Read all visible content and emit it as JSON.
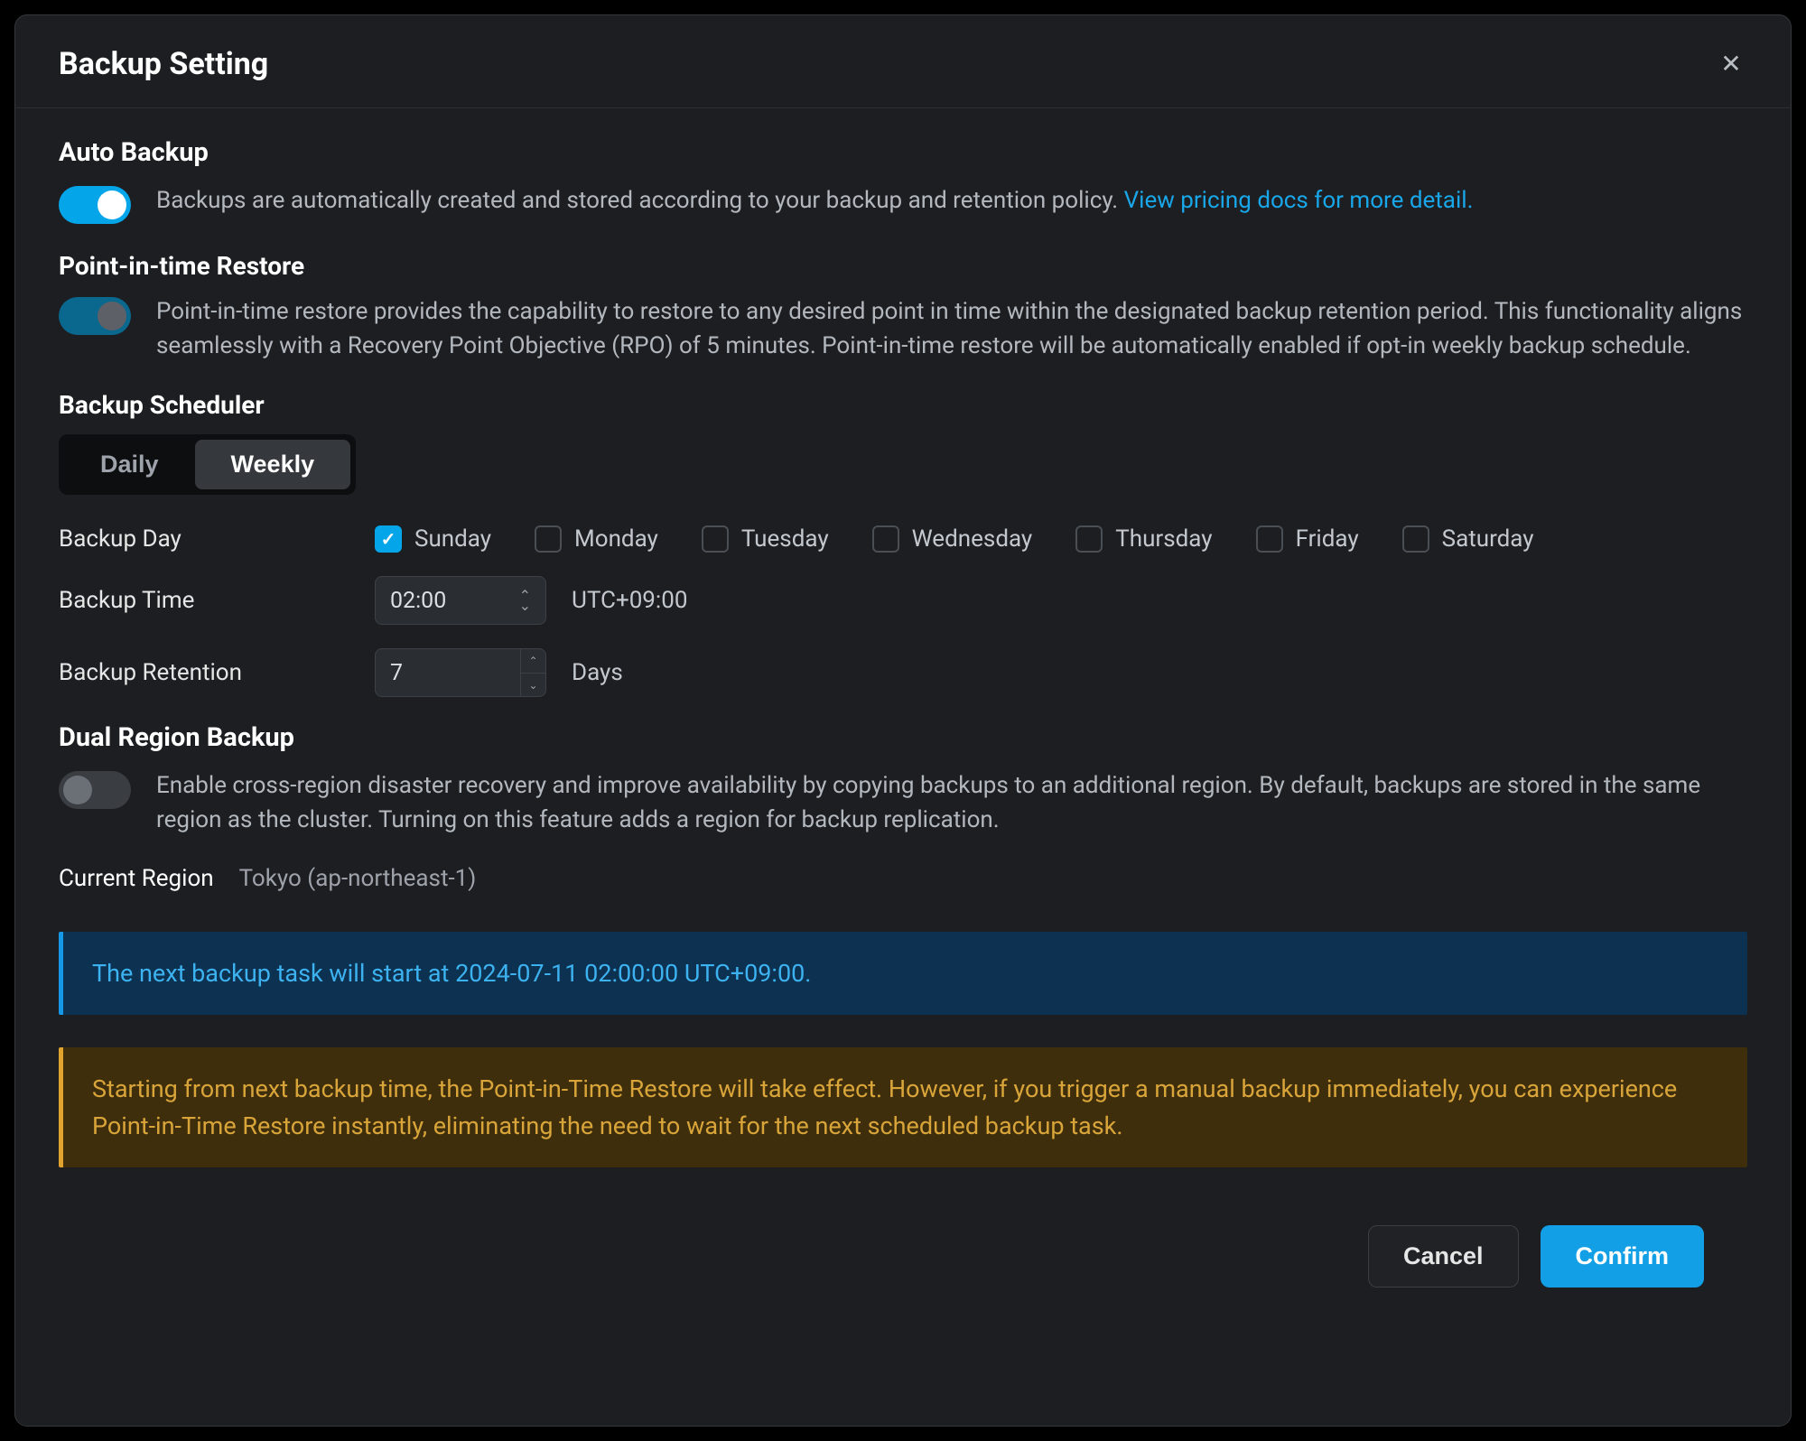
{
  "modal": {
    "title": "Backup Setting"
  },
  "autoBackup": {
    "title": "Auto Backup",
    "description": "Backups are automatically created and stored according to your backup and retention policy. ",
    "link": "View pricing docs for more detail.",
    "enabled": true
  },
  "pitr": {
    "title": "Point-in-time Restore",
    "description": "Point-in-time restore provides the capability to restore to any desired point in time within the designated backup retention period. This functionality aligns seamlessly with a Recovery Point Objective (RPO) of 5 minutes. Point-in-time restore will be automatically enabled if opt-in weekly backup schedule.",
    "enabled": true
  },
  "scheduler": {
    "title": "Backup Scheduler",
    "tabs": {
      "daily": "Daily",
      "weekly": "Weekly"
    },
    "activeTab": "weekly",
    "dayLabel": "Backup Day",
    "days": {
      "sunday": {
        "label": "Sunday",
        "checked": true
      },
      "monday": {
        "label": "Monday",
        "checked": false
      },
      "tuesday": {
        "label": "Tuesday",
        "checked": false
      },
      "wednesday": {
        "label": "Wednesday",
        "checked": false
      },
      "thursday": {
        "label": "Thursday",
        "checked": false
      },
      "friday": {
        "label": "Friday",
        "checked": false
      },
      "saturday": {
        "label": "Saturday",
        "checked": false
      }
    },
    "timeLabel": "Backup Time",
    "timeValue": "02:00",
    "timezone": "UTC+09:00",
    "retentionLabel": "Backup Retention",
    "retentionValue": "7",
    "retentionUnit": "Days"
  },
  "dualRegion": {
    "title": "Dual Region Backup",
    "description": "Enable cross-region disaster recovery and improve availability by copying backups to an additional region. By default, backups are stored in the same region as the cluster. Turning on this feature adds a region for backup replication.",
    "enabled": false,
    "currentRegionLabel": "Current Region",
    "currentRegionValue": "Tokyo (ap-northeast-1)"
  },
  "banners": {
    "info": "The next backup task will start at 2024-07-11 02:00:00 UTC+09:00.",
    "warn": "Starting from next backup time, the Point-in-Time Restore will take effect. However, if you trigger a manual backup immediately, you can experience Point-in-Time Restore instantly, eliminating the need to wait for the next scheduled backup task."
  },
  "footer": {
    "cancel": "Cancel",
    "confirm": "Confirm"
  }
}
